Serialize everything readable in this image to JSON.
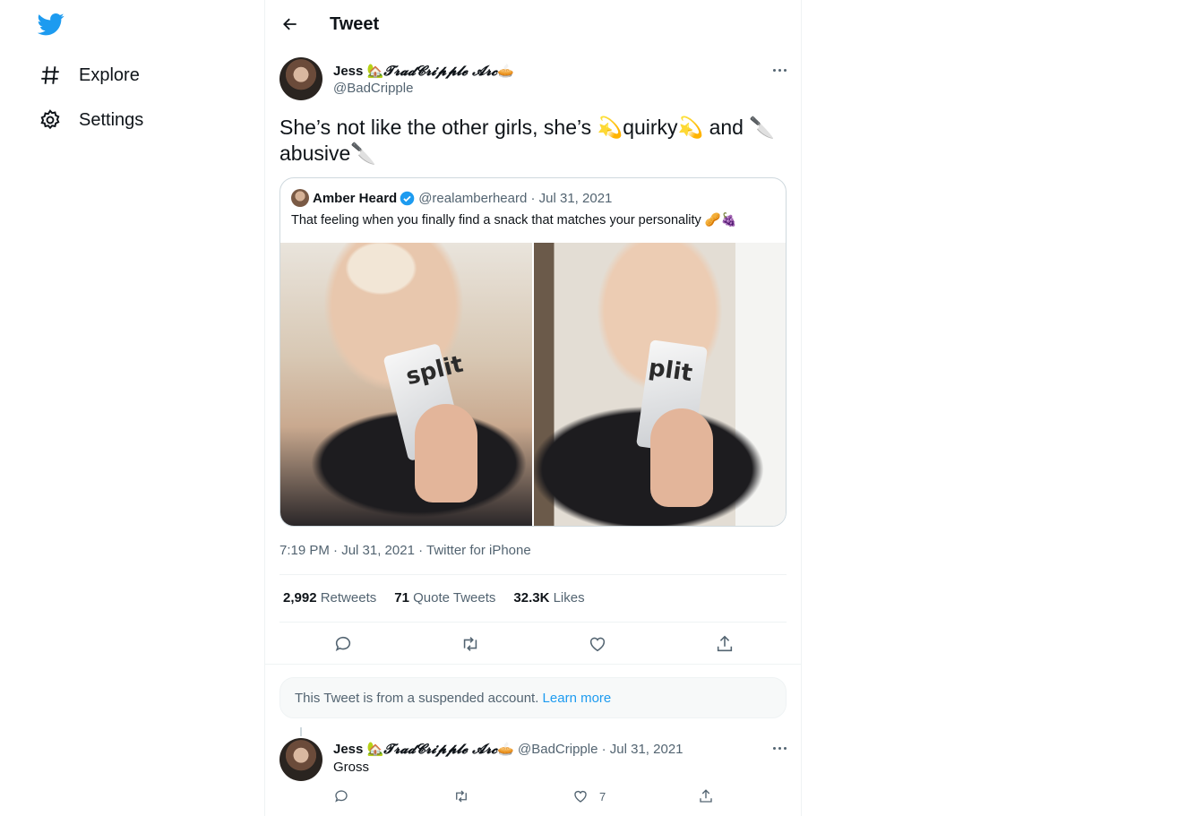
{
  "nav": {
    "logo": "twitter-bird-icon",
    "items": [
      {
        "label": "Explore",
        "icon": "hashtag-icon"
      },
      {
        "label": "Settings",
        "icon": "gear-icon"
      }
    ]
  },
  "header": {
    "title": "Tweet"
  },
  "tweet": {
    "author_name": "Jess",
    "author_name_deco": "𝓣𝓻𝓪𝓭𝓒𝓻𝓲𝓹𝓹𝓵𝓮 𝓐𝓻𝓬",
    "author_emoji_before": "🏡",
    "author_emoji_after": "🥧",
    "handle": "@BadCripple",
    "text_line1": "She’s not like the other girls, she’s 💫quirky💫 and 🔪",
    "text_line2": "abusive🔪",
    "meta": "7:19 PM · Jul 31, 2021 · Twitter for iPhone",
    "stats": [
      {
        "value": "2,992",
        "label": "Retweets"
      },
      {
        "value": "71",
        "label": "Quote Tweets"
      },
      {
        "value": "32.3K",
        "label": "Likes"
      }
    ]
  },
  "quote": {
    "name": "Amber Heard",
    "handle_date": "@realamberheard · Jul 31, 2021",
    "text": "That feeling when you finally find a snack that matches your personality 🥜🍇",
    "pouch1": "split",
    "pouch2": "plit"
  },
  "notice": {
    "text": "This Tweet is from a suspended account.",
    "link": "Learn more"
  },
  "reply": {
    "author_name": "Jess",
    "author_name_deco": "𝓣𝓻𝓪𝓭𝓒𝓻𝓲𝓹𝓹𝓵𝓮 𝓐𝓻𝓬",
    "author_emoji_before": "🏡",
    "author_emoji_after": "🥧",
    "handle_date": "@BadCripple · Jul 31, 2021",
    "text": "Gross",
    "like_count": "7"
  },
  "colors": {
    "accent": "#1d9bf0",
    "text": "#0f1419",
    "muted": "#536471",
    "border": "#eff3f4"
  }
}
